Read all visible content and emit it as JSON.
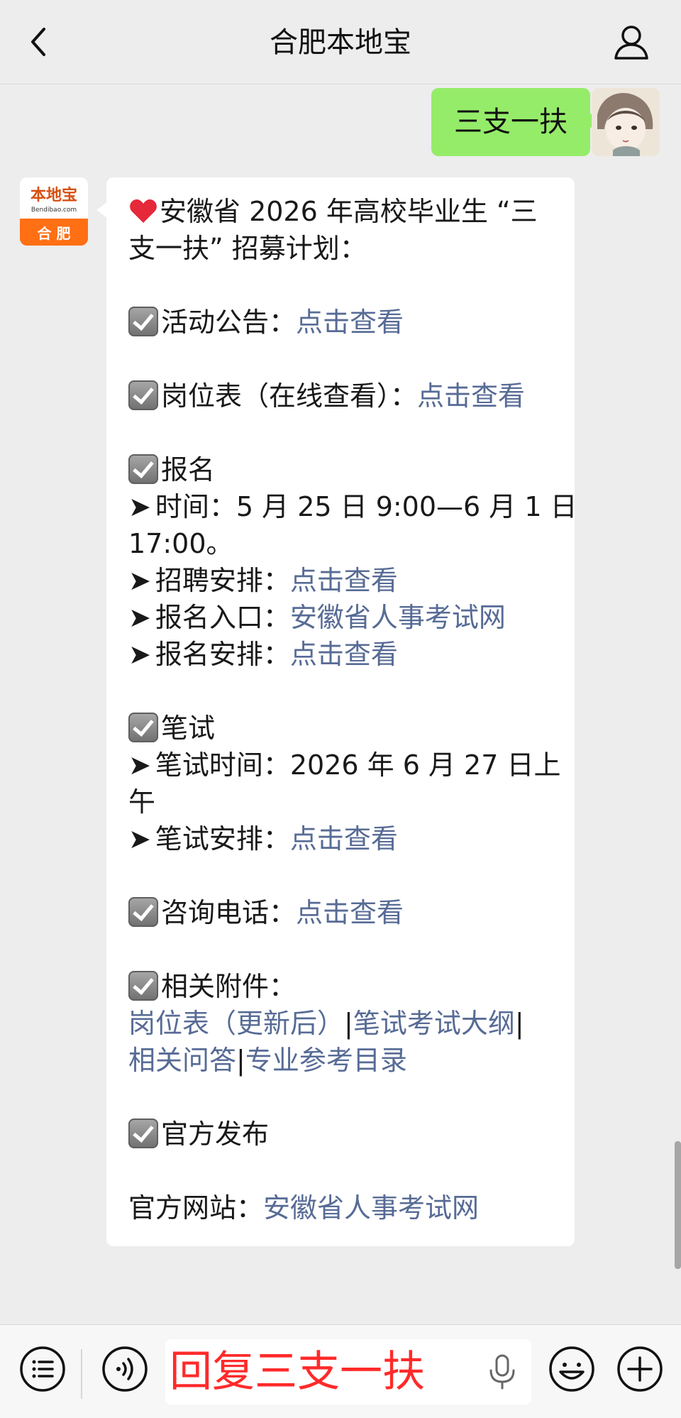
{
  "header": {
    "title": "合肥本地宝"
  },
  "conversation": {
    "me_message": "三支一扶",
    "bot_logo": {
      "line1": "本地宝",
      "line2": "Bendibao.com",
      "line3": "合 肥"
    },
    "reply": {
      "intro_line1": "安徽省 2026 年高校毕业生 “三",
      "intro_line2": "支一扶” 招募计划：",
      "activity_label": "活动公告：",
      "activity_link": "点击查看",
      "post_label": "岗位表（在线查看）：",
      "post_link": "点击查看",
      "registration_label": "报名",
      "time_label": "时间：",
      "time_value": "5 月 25 日 9:00—6 月 1 日",
      "time_value_cont": "17:00。",
      "recruit_label": "招聘安排：",
      "recruit_link": "点击查看",
      "entry_label": "报名入口：",
      "entry_link": "安徽省人事考试网",
      "arrangement_label": "报名安排：",
      "arrangement_link": "点击查看",
      "exam_label": "笔试",
      "exam_time_label": "笔试时间：",
      "exam_time_value": "2026 年 6 月 27 日上",
      "exam_time_value_cont": "午",
      "exam_arrangement_label": "笔试安排：",
      "exam_arrangement_link": "点击查看",
      "phone_label": "咨询电话：",
      "phone_link": "点击查看",
      "attachments_label": "相关附件：",
      "attachment_links": [
        "岗位表（更新后）",
        "笔试考试大纲",
        "相关问答",
        "专业参考目录"
      ],
      "separator": "|",
      "official_label": "官方发布",
      "official_site_label": "官方网站：",
      "official_site_link": "安徽省人事考试网"
    }
  },
  "input_bar": {
    "text": "回复三支一扶"
  },
  "icons": {
    "back": "chevron-left-icon",
    "user": "user-icon",
    "heart": "heart-icon",
    "check": "check-box-icon",
    "menu": "menu-list-icon",
    "voice": "voice-icon",
    "mic": "microphone-icon",
    "emoji": "emoji-icon",
    "add": "add-icon"
  },
  "colors": {
    "background": "#ededed",
    "my_bubble": "#95ec69",
    "link": "#576b95",
    "input_text": "#ff2a2a"
  }
}
